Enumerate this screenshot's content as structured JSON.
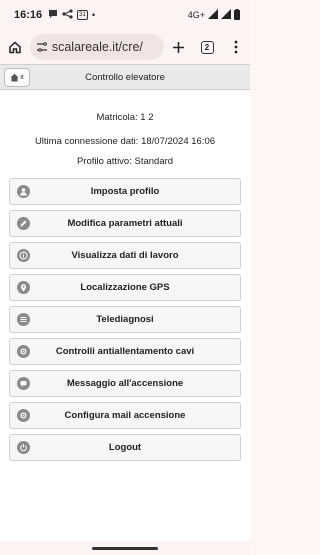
{
  "status_bar": {
    "time": "16:16",
    "network": "4G+",
    "calendar_day": "31"
  },
  "browser": {
    "url": "scalareale.it/cre/",
    "tab_count": "2"
  },
  "app": {
    "home_label": "it",
    "title": "Controllo elevatore",
    "matricola_label": "Matricola: 1     2",
    "last_connection": "Ultima connessione dati: 18/07/2024 16:06",
    "active_profile": "Profilo attivo: Standard"
  },
  "menu": [
    {
      "label": "Imposta profilo",
      "icon": "user-icon"
    },
    {
      "label": "Modifica parametri attuali",
      "icon": "pencil-icon"
    },
    {
      "label": "Visualizza dati di lavoro",
      "icon": "info-icon"
    },
    {
      "label": "Localizzazione GPS",
      "icon": "location-pin-icon"
    },
    {
      "label": "Telediagnosi",
      "icon": "list-icon"
    },
    {
      "label": "Controlli antiallentamento cavi",
      "icon": "gear-icon"
    },
    {
      "label": "Messaggio all'accensione",
      "icon": "message-icon"
    },
    {
      "label": "Configura mail accensione",
      "icon": "gear-icon"
    },
    {
      "label": "Logout",
      "icon": "power-icon"
    }
  ]
}
